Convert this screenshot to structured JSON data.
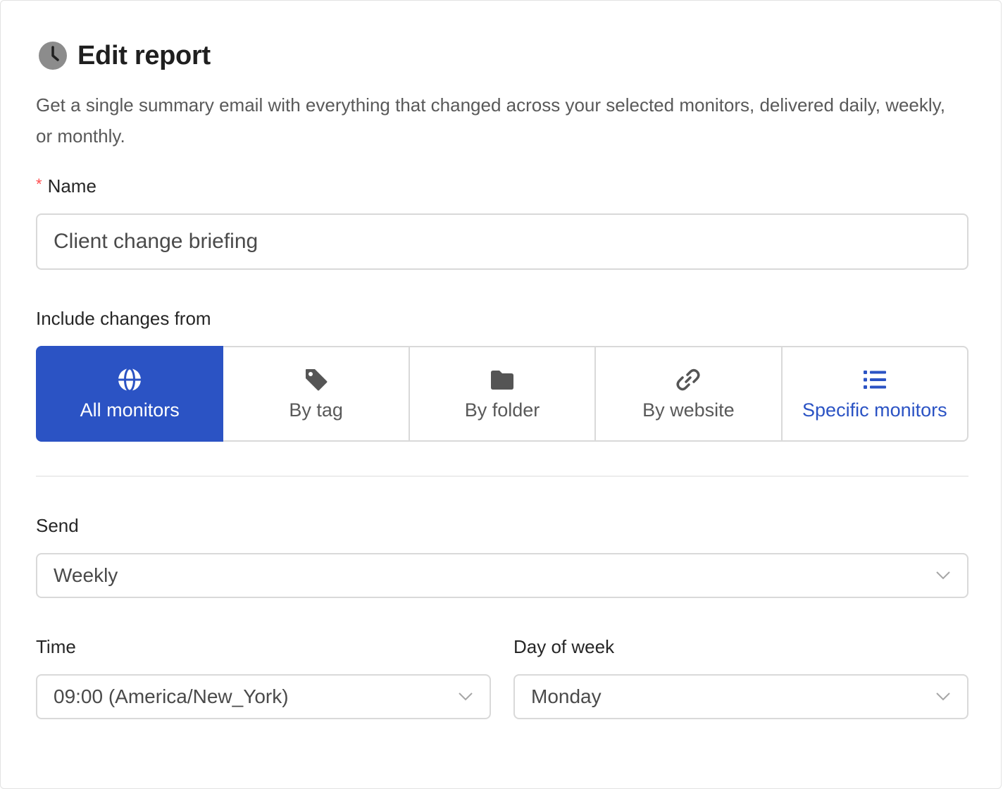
{
  "header": {
    "title": "Edit report",
    "icon": "clock-icon"
  },
  "description": "Get a single summary email with everything that changed across your selected monitors, delivered daily, weekly, or monthly.",
  "name_field": {
    "required_marker": "*",
    "label": "Name",
    "value": "Client change briefing"
  },
  "include": {
    "label": "Include changes from",
    "selected": "All monitors",
    "options": [
      {
        "label": "All monitors",
        "icon": "globe-icon"
      },
      {
        "label": "By tag",
        "icon": "tag-icon"
      },
      {
        "label": "By folder",
        "icon": "folder-icon"
      },
      {
        "label": "By website",
        "icon": "link-icon"
      },
      {
        "label": "Specific monitors",
        "icon": "list-icon"
      }
    ]
  },
  "send": {
    "label": "Send",
    "value": "Weekly"
  },
  "time": {
    "label": "Time",
    "value": "09:00 (America/New_York)"
  },
  "day_of_week": {
    "label": "Day of week",
    "value": "Monday"
  },
  "colors": {
    "accent": "#2b53c4",
    "required": "#ff4d4f",
    "border": "#d9d9d9",
    "muted_text": "#595959"
  }
}
